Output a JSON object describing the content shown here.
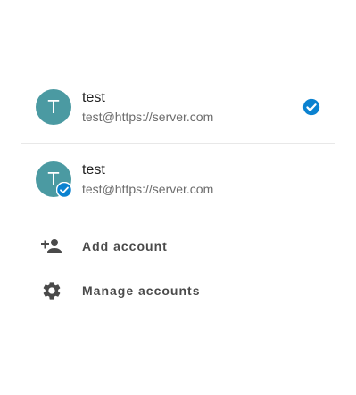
{
  "accounts": [
    {
      "avatar_letter": "T",
      "name": "test",
      "email": "test@https://server.com",
      "selected": true
    },
    {
      "avatar_letter": "T",
      "name": "test",
      "email": "test@https://server.com",
      "badge_icon": "verified-badge-icon"
    }
  ],
  "actions": {
    "add_account_label": "Add account",
    "add_account_icon": "person-add-icon",
    "manage_accounts_label": "Manage accounts",
    "manage_accounts_icon": "gear-icon"
  },
  "colors": {
    "avatar": "#4b9aa2",
    "accent": "#0b82d0",
    "secondary_text": "#6b6b6b",
    "action_text": "#4a4a4a"
  }
}
